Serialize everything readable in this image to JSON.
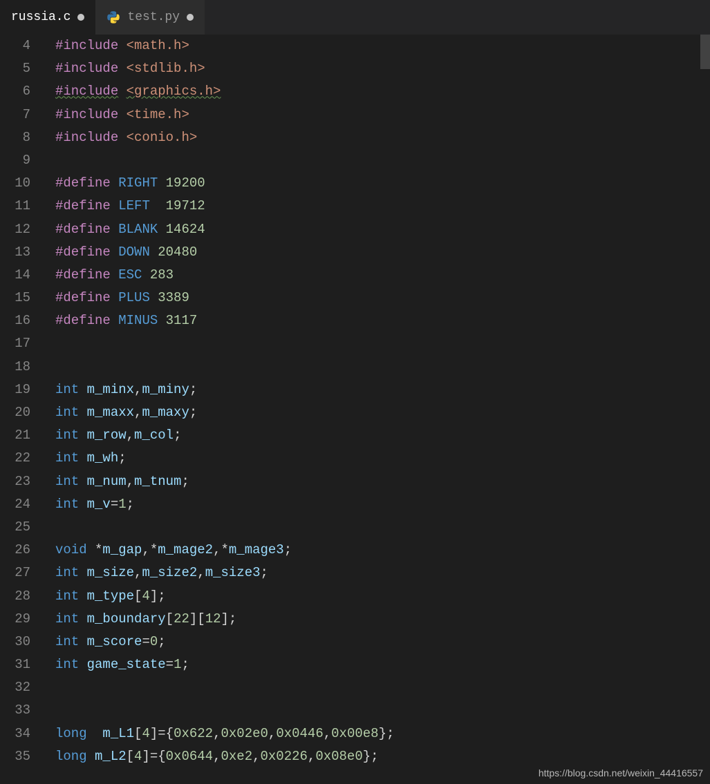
{
  "tabs": [
    {
      "label": "russia.c",
      "active": true,
      "modified": true,
      "icon": null
    },
    {
      "label": "test.py",
      "active": false,
      "modified": true,
      "icon": "python"
    }
  ],
  "watermark": "https://blog.csdn.net/weixin_44416557",
  "first_line_number": 4,
  "code_lines": [
    {
      "n": 4,
      "tokens": [
        [
          "pp",
          "#include"
        ],
        [
          "sp",
          " "
        ],
        [
          "inc",
          "<math.h>"
        ]
      ]
    },
    {
      "n": 5,
      "tokens": [
        [
          "pp",
          "#include"
        ],
        [
          "sp",
          " "
        ],
        [
          "inc",
          "<stdlib.h>"
        ]
      ]
    },
    {
      "n": 6,
      "tokens": [
        [
          "pp-sq",
          "#include"
        ],
        [
          "sp",
          " "
        ],
        [
          "inc-sq",
          "<graphics.h>"
        ]
      ]
    },
    {
      "n": 7,
      "tokens": [
        [
          "pp",
          "#include"
        ],
        [
          "sp",
          " "
        ],
        [
          "inc",
          "<time.h>"
        ]
      ]
    },
    {
      "n": 8,
      "tokens": [
        [
          "pp",
          "#include"
        ],
        [
          "sp",
          " "
        ],
        [
          "inc",
          "<conio.h>"
        ]
      ]
    },
    {
      "n": 9,
      "tokens": []
    },
    {
      "n": 10,
      "tokens": [
        [
          "pp",
          "#define"
        ],
        [
          "sp",
          " "
        ],
        [
          "kw",
          "RIGHT"
        ],
        [
          "sp",
          " "
        ],
        [
          "num",
          "19200"
        ]
      ]
    },
    {
      "n": 11,
      "tokens": [
        [
          "pp",
          "#define"
        ],
        [
          "sp",
          " "
        ],
        [
          "kw",
          "LEFT"
        ],
        [
          "sp",
          "  "
        ],
        [
          "num",
          "19712"
        ]
      ]
    },
    {
      "n": 12,
      "tokens": [
        [
          "pp",
          "#define"
        ],
        [
          "sp",
          " "
        ],
        [
          "kw",
          "BLANK"
        ],
        [
          "sp",
          " "
        ],
        [
          "num",
          "14624"
        ]
      ]
    },
    {
      "n": 13,
      "tokens": [
        [
          "pp",
          "#define"
        ],
        [
          "sp",
          " "
        ],
        [
          "kw",
          "DOWN"
        ],
        [
          "sp",
          " "
        ],
        [
          "num",
          "20480"
        ]
      ]
    },
    {
      "n": 14,
      "tokens": [
        [
          "pp",
          "#define"
        ],
        [
          "sp",
          " "
        ],
        [
          "kw",
          "ESC"
        ],
        [
          "sp",
          " "
        ],
        [
          "num",
          "283"
        ]
      ]
    },
    {
      "n": 15,
      "tokens": [
        [
          "pp",
          "#define"
        ],
        [
          "sp",
          " "
        ],
        [
          "kw",
          "PLUS"
        ],
        [
          "sp",
          " "
        ],
        [
          "num",
          "3389"
        ]
      ]
    },
    {
      "n": 16,
      "tokens": [
        [
          "pp",
          "#define"
        ],
        [
          "sp",
          " "
        ],
        [
          "kw",
          "MINUS"
        ],
        [
          "sp",
          " "
        ],
        [
          "num",
          "3117"
        ]
      ]
    },
    {
      "n": 17,
      "tokens": []
    },
    {
      "n": 18,
      "tokens": []
    },
    {
      "n": 19,
      "tokens": [
        [
          "kw",
          "int"
        ],
        [
          "sp",
          " "
        ],
        [
          "var",
          "m_minx"
        ],
        [
          "ident",
          ","
        ],
        [
          "var",
          "m_miny"
        ],
        [
          "ident",
          ";"
        ]
      ]
    },
    {
      "n": 20,
      "tokens": [
        [
          "kw",
          "int"
        ],
        [
          "sp",
          " "
        ],
        [
          "var",
          "m_maxx"
        ],
        [
          "ident",
          ","
        ],
        [
          "var",
          "m_maxy"
        ],
        [
          "ident",
          ";"
        ]
      ]
    },
    {
      "n": 21,
      "tokens": [
        [
          "kw",
          "int"
        ],
        [
          "sp",
          " "
        ],
        [
          "var",
          "m_row"
        ],
        [
          "ident",
          ","
        ],
        [
          "var",
          "m_col"
        ],
        [
          "ident",
          ";"
        ]
      ]
    },
    {
      "n": 22,
      "tokens": [
        [
          "kw",
          "int"
        ],
        [
          "sp",
          " "
        ],
        [
          "var",
          "m_wh"
        ],
        [
          "ident",
          ";"
        ]
      ]
    },
    {
      "n": 23,
      "tokens": [
        [
          "kw",
          "int"
        ],
        [
          "sp",
          " "
        ],
        [
          "var",
          "m_num"
        ],
        [
          "ident",
          ","
        ],
        [
          "var",
          "m_tnum"
        ],
        [
          "ident",
          ";"
        ]
      ]
    },
    {
      "n": 24,
      "tokens": [
        [
          "kw",
          "int"
        ],
        [
          "sp",
          " "
        ],
        [
          "var",
          "m_v"
        ],
        [
          "ident",
          "="
        ],
        [
          "num",
          "1"
        ],
        [
          "ident",
          ";"
        ]
      ]
    },
    {
      "n": 25,
      "tokens": []
    },
    {
      "n": 26,
      "tokens": [
        [
          "kw",
          "void"
        ],
        [
          "sp",
          " "
        ],
        [
          "ident",
          "*"
        ],
        [
          "var",
          "m_gap"
        ],
        [
          "ident",
          ",*"
        ],
        [
          "var",
          "m_mage2"
        ],
        [
          "ident",
          ",*"
        ],
        [
          "var",
          "m_mage3"
        ],
        [
          "ident",
          ";"
        ]
      ]
    },
    {
      "n": 27,
      "tokens": [
        [
          "kw",
          "int"
        ],
        [
          "sp",
          " "
        ],
        [
          "var",
          "m_size"
        ],
        [
          "ident",
          ","
        ],
        [
          "var",
          "m_size2"
        ],
        [
          "ident",
          ","
        ],
        [
          "var",
          "m_size3"
        ],
        [
          "ident",
          ";"
        ]
      ]
    },
    {
      "n": 28,
      "tokens": [
        [
          "kw",
          "int"
        ],
        [
          "sp",
          " "
        ],
        [
          "var",
          "m_type"
        ],
        [
          "ident",
          "["
        ],
        [
          "num",
          "4"
        ],
        [
          "ident",
          "];"
        ]
      ]
    },
    {
      "n": 29,
      "tokens": [
        [
          "kw",
          "int"
        ],
        [
          "sp",
          " "
        ],
        [
          "var",
          "m_boundary"
        ],
        [
          "ident",
          "["
        ],
        [
          "num",
          "22"
        ],
        [
          "ident",
          "]["
        ],
        [
          "num",
          "12"
        ],
        [
          "ident",
          "];"
        ]
      ]
    },
    {
      "n": 30,
      "tokens": [
        [
          "kw",
          "int"
        ],
        [
          "sp",
          " "
        ],
        [
          "var",
          "m_score"
        ],
        [
          "ident",
          "="
        ],
        [
          "num",
          "0"
        ],
        [
          "ident",
          ";"
        ]
      ]
    },
    {
      "n": 31,
      "tokens": [
        [
          "kw",
          "int"
        ],
        [
          "sp",
          " "
        ],
        [
          "var",
          "game_state"
        ],
        [
          "ident",
          "="
        ],
        [
          "num",
          "1"
        ],
        [
          "ident",
          ";"
        ]
      ]
    },
    {
      "n": 32,
      "tokens": []
    },
    {
      "n": 33,
      "tokens": []
    },
    {
      "n": 34,
      "tokens": [
        [
          "kw",
          "long"
        ],
        [
          "sp",
          "  "
        ],
        [
          "var",
          "m_L1"
        ],
        [
          "ident",
          "["
        ],
        [
          "num",
          "4"
        ],
        [
          "ident",
          "]={"
        ],
        [
          "num",
          "0x622"
        ],
        [
          "ident",
          ","
        ],
        [
          "num",
          "0x02e0"
        ],
        [
          "ident",
          ","
        ],
        [
          "num",
          "0x0446"
        ],
        [
          "ident",
          ","
        ],
        [
          "num",
          "0x00e8"
        ],
        [
          "ident",
          "};"
        ]
      ]
    },
    {
      "n": 35,
      "tokens": [
        [
          "kw",
          "long"
        ],
        [
          "sp",
          " "
        ],
        [
          "var",
          "m_L2"
        ],
        [
          "ident",
          "["
        ],
        [
          "num",
          "4"
        ],
        [
          "ident",
          "]={"
        ],
        [
          "num",
          "0x0644"
        ],
        [
          "ident",
          ","
        ],
        [
          "num",
          "0xe2"
        ],
        [
          "ident",
          ","
        ],
        [
          "num",
          "0x0226"
        ],
        [
          "ident",
          ","
        ],
        [
          "num",
          "0x08e0"
        ],
        [
          "ident",
          "};"
        ]
      ]
    }
  ]
}
